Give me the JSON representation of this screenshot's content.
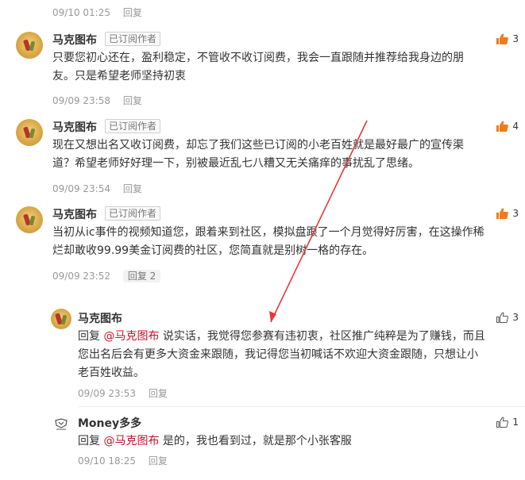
{
  "top": {
    "timestamp": "09/10 01:25",
    "reply_label": "回复"
  },
  "comments": [
    {
      "name": "马克图布",
      "badge": "已订阅作者",
      "line1": "只要您初心还在，盈利稳定，不管收不收订阅费，我会一直跟随并推荐给我身边的朋",
      "line2": "友。只是希望老师坚持初衷",
      "timestamp": "09/09 23:58",
      "reply_label": "回复",
      "likes": "3"
    },
    {
      "name": "马克图布",
      "badge": "已订阅作者",
      "line1": "现在又想出名又收订阅费，却忘了我们这些已订阅的小老百姓就是最好最广的宣传渠",
      "line2": "道？希望老师好好理一下，别被最近乱七八糟又无关痛痒的事扰乱了思绪。",
      "timestamp": "09/09 23:54",
      "reply_label": "回复",
      "likes": "4"
    },
    {
      "name": "马克图布",
      "badge": "已订阅作者",
      "line1": "当初从ic事件的视频知道您，跟着来到社区，模拟盘跟了一个月觉得好厉害，在这操作稀",
      "line2": "烂却敢收99.99美金订阅费的社区，您简直就是别树一格的存在。",
      "timestamp": "09/09 23:52",
      "reply_label": "回复 2",
      "likes": "3"
    }
  ],
  "replies": [
    {
      "name": "马克图布",
      "reply_prefix": "回复",
      "mention": "@马克图布",
      "line1": "说实话，我觉得您参赛有违初衷，社区推广纯粹是为了赚钱，而且",
      "line2": "您出名后会有更多大资金来跟随，我记得您当初喊话不欢迎大资金跟随，只想让小",
      "line3": "老百姓收益。",
      "timestamp": "09/09 23:53",
      "reply_label": "回复",
      "likes": "3"
    },
    {
      "name": "Money多多",
      "reply_prefix": "回复",
      "mention": "@马克图布",
      "line1": "是的，我也看到过，就是那个小张客服",
      "timestamp": "09/10 18:25",
      "reply_label": "回复",
      "likes": "1"
    }
  ],
  "colors": {
    "accent": "#c8102e",
    "like_fill": "#f07a1a",
    "arrow": "#e53935"
  }
}
